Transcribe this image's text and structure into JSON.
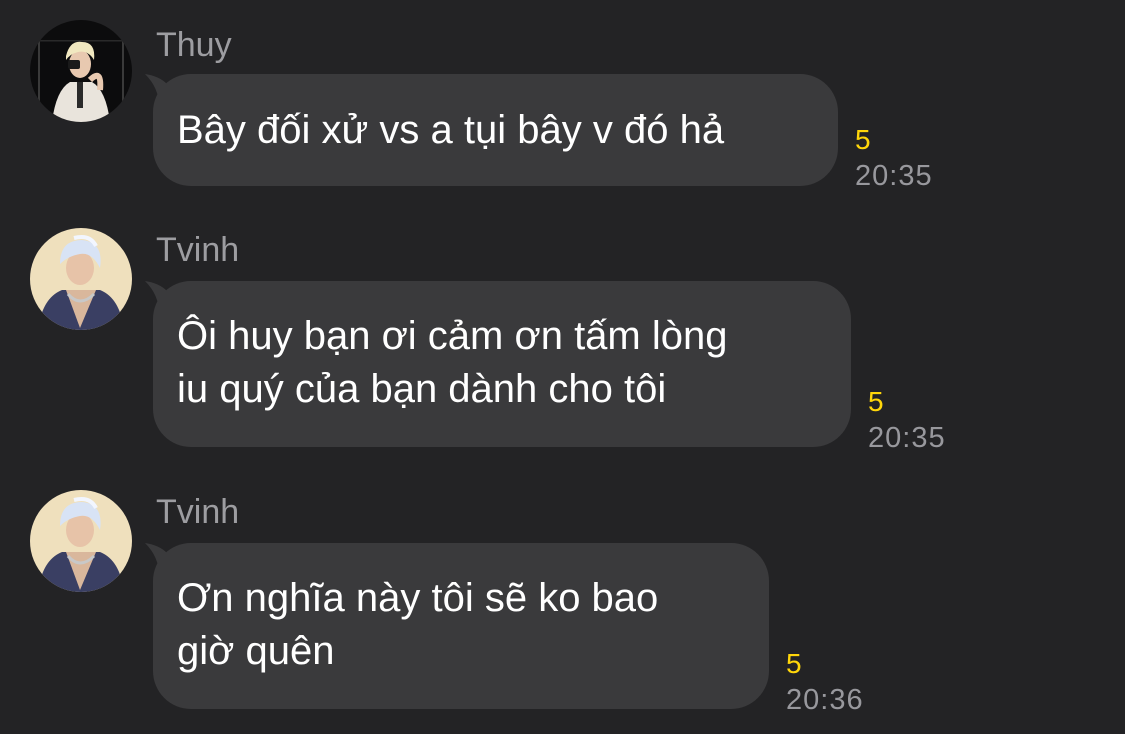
{
  "colors": {
    "background": "#232325",
    "bubble": "#3a3a3c",
    "message_text": "#ffffff",
    "sender_name": "#9d9da1",
    "seen_count": "#ffd60a",
    "timestamp": "#98989d"
  },
  "messages": [
    {
      "sender": "Thuy",
      "avatar": "avatar-photo-thuy",
      "text": "Bây đối xử vs a tụi bây v đó hả",
      "seen_count": "5",
      "time": "20:35"
    },
    {
      "sender": "Tvinh",
      "avatar": "avatar-photo-tvinh",
      "text": "Ôi huy bạn ơi cảm ơn tấm lòng\niu quý của bạn dành cho tôi",
      "seen_count": "5",
      "time": "20:35"
    },
    {
      "sender": "Tvinh",
      "avatar": "avatar-photo-tvinh",
      "text": "Ơn nghĩa này tôi sẽ ko bao\ngiờ quên",
      "seen_count": "5",
      "time": "20:36"
    }
  ]
}
